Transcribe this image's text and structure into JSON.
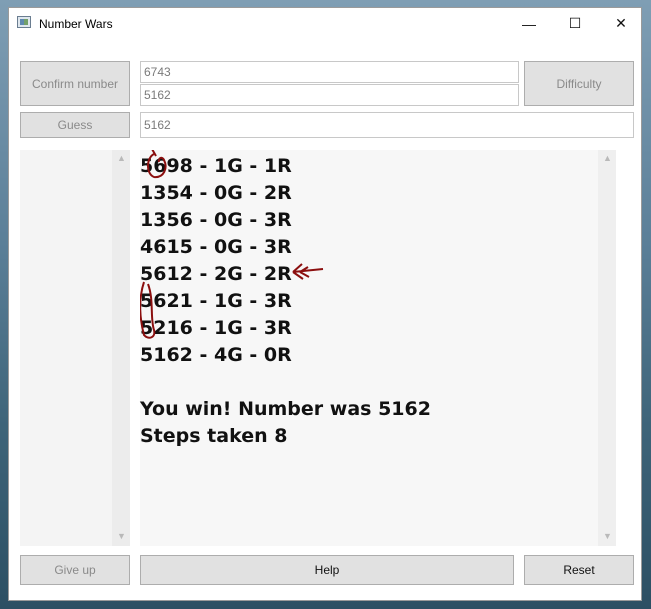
{
  "window": {
    "title": "Number Wars",
    "minimize_symbol": "—",
    "maximize_symbol": "☐",
    "close_symbol": "✕"
  },
  "toolbar": {
    "confirm_label": "Confirm number",
    "guess_label": "Guess",
    "difficulty_label": "Difficulty",
    "secret_number": "6743",
    "confirmed_number": "5162",
    "guess_input": "5162"
  },
  "log": {
    "lines": [
      "5698 - 1G - 1R",
      "1354 - 0G - 2R",
      "1356 - 0G - 3R",
      "4615 - 0G - 3R",
      "5612 - 2G - 2R",
      "5621 - 1G - 3R",
      "5216 - 1G - 3R",
      "5162 - 4G - 0R",
      "",
      "You win! Number was 5162",
      "Steps taken 8"
    ]
  },
  "footer": {
    "give_up_label": "Give up",
    "help_label": "Help",
    "reset_label": "Reset"
  },
  "annotation_color": "#8b0f0f"
}
